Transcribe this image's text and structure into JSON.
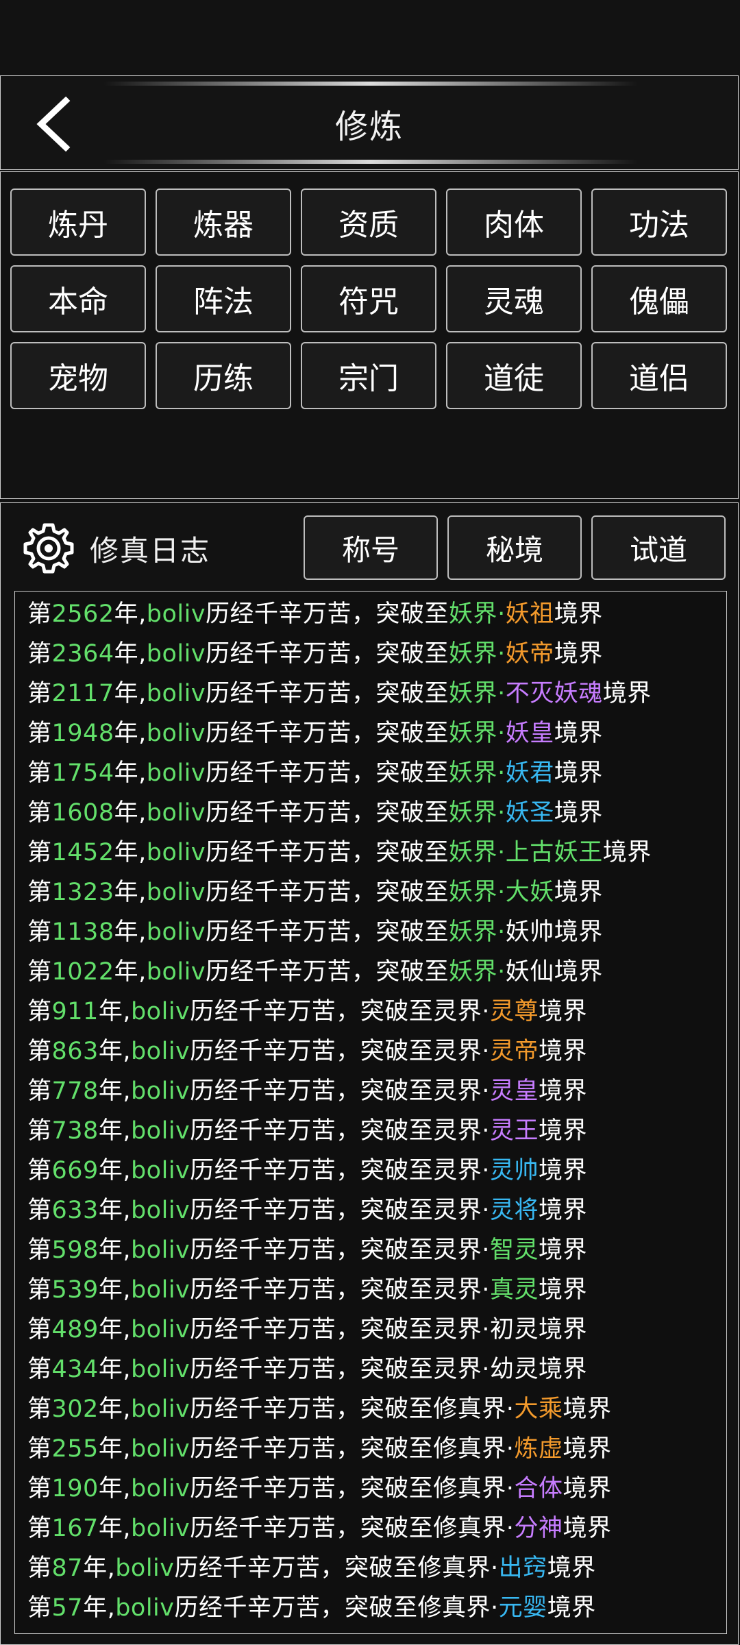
{
  "header": {
    "title": "修炼"
  },
  "grid": {
    "buttons": [
      "炼丹",
      "炼器",
      "资质",
      "肉体",
      "功法",
      "本命",
      "阵法",
      "符咒",
      "灵魂",
      "傀儡",
      "宠物",
      "历练",
      "宗门",
      "道徒",
      "道侣"
    ]
  },
  "journal": {
    "title": "修真日志",
    "tabs": [
      "称号",
      "秘境",
      "试道"
    ],
    "text": {
      "prefix": "第",
      "year_unit": "年,",
      "name": "boliv",
      "phrase": "历经千辛万苦，突破至",
      "dot": "·",
      "suffix": "境界"
    },
    "colors": {
      "green": "#63e06b",
      "white": "#ffffff",
      "orange": "#f39a2c",
      "purple": "#c77dff",
      "blue": "#38b8f2"
    },
    "entries": [
      {
        "year": "2562",
        "realm": "妖界",
        "realm_color": "green",
        "stage": "妖祖",
        "stage_color": "orange"
      },
      {
        "year": "2364",
        "realm": "妖界",
        "realm_color": "green",
        "stage": "妖帝",
        "stage_color": "orange"
      },
      {
        "year": "2117",
        "realm": "妖界",
        "realm_color": "green",
        "stage": "不灭妖魂",
        "stage_color": "purple"
      },
      {
        "year": "1948",
        "realm": "妖界",
        "realm_color": "green",
        "stage": "妖皇",
        "stage_color": "purple"
      },
      {
        "year": "1754",
        "realm": "妖界",
        "realm_color": "green",
        "stage": "妖君",
        "stage_color": "blue"
      },
      {
        "year": "1608",
        "realm": "妖界",
        "realm_color": "green",
        "stage": "妖圣",
        "stage_color": "blue"
      },
      {
        "year": "1452",
        "realm": "妖界",
        "realm_color": "green",
        "stage": "上古妖王",
        "stage_color": "green"
      },
      {
        "year": "1323",
        "realm": "妖界",
        "realm_color": "green",
        "stage": "大妖",
        "stage_color": "green"
      },
      {
        "year": "1138",
        "realm": "妖界",
        "realm_color": "green",
        "stage": "妖帅",
        "stage_color": "white"
      },
      {
        "year": "1022",
        "realm": "妖界",
        "realm_color": "green",
        "stage": "妖仙",
        "stage_color": "white"
      },
      {
        "year": "911",
        "realm": "灵界",
        "realm_color": "white",
        "stage": "灵尊",
        "stage_color": "orange"
      },
      {
        "year": "863",
        "realm": "灵界",
        "realm_color": "white",
        "stage": "灵帝",
        "stage_color": "orange"
      },
      {
        "year": "778",
        "realm": "灵界",
        "realm_color": "white",
        "stage": "灵皇",
        "stage_color": "purple"
      },
      {
        "year": "738",
        "realm": "灵界",
        "realm_color": "white",
        "stage": "灵王",
        "stage_color": "purple"
      },
      {
        "year": "669",
        "realm": "灵界",
        "realm_color": "white",
        "stage": "灵帅",
        "stage_color": "blue"
      },
      {
        "year": "633",
        "realm": "灵界",
        "realm_color": "white",
        "stage": "灵将",
        "stage_color": "blue"
      },
      {
        "year": "598",
        "realm": "灵界",
        "realm_color": "white",
        "stage": "智灵",
        "stage_color": "green"
      },
      {
        "year": "539",
        "realm": "灵界",
        "realm_color": "white",
        "stage": "真灵",
        "stage_color": "green"
      },
      {
        "year": "489",
        "realm": "灵界",
        "realm_color": "white",
        "stage": "初灵",
        "stage_color": "white"
      },
      {
        "year": "434",
        "realm": "灵界",
        "realm_color": "white",
        "stage": "幼灵",
        "stage_color": "white"
      },
      {
        "year": "302",
        "realm": "修真界",
        "realm_color": "white",
        "stage": "大乘",
        "stage_color": "orange"
      },
      {
        "year": "255",
        "realm": "修真界",
        "realm_color": "white",
        "stage": "炼虚",
        "stage_color": "orange"
      },
      {
        "year": "190",
        "realm": "修真界",
        "realm_color": "white",
        "stage": "合体",
        "stage_color": "purple"
      },
      {
        "year": "167",
        "realm": "修真界",
        "realm_color": "white",
        "stage": "分神",
        "stage_color": "purple"
      },
      {
        "year": "87",
        "realm": "修真界",
        "realm_color": "white",
        "stage": "出窍",
        "stage_color": "blue"
      },
      {
        "year": "57",
        "realm": "修真界",
        "realm_color": "white",
        "stage": "元婴",
        "stage_color": "blue"
      }
    ]
  }
}
